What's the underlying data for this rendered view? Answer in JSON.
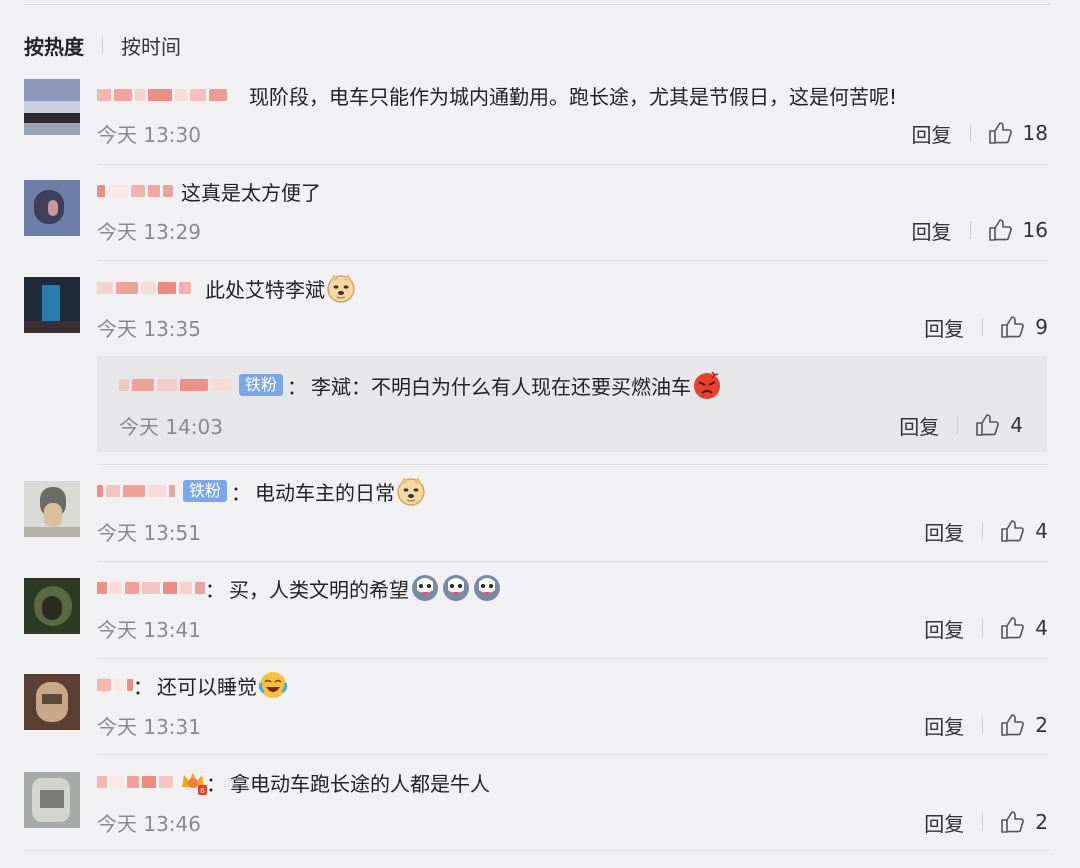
{
  "sort": {
    "hot_label": "按热度",
    "time_label": "按时间"
  },
  "reply_label": "回复",
  "colors": {
    "background": "#f1f1f3",
    "badge": "#7aa7e8",
    "time_text": "#8a8a8a"
  },
  "comments": [
    {
      "username": "",
      "text": "现阶段，电车只能作为城内通勤用。跑长途，尤其是节假日，这是何苦呢!",
      "time": "今天 13:30",
      "likes": "18",
      "emoji": []
    },
    {
      "username": "",
      "text": "这真是太方便了",
      "time": "今天 13:29",
      "likes": "16",
      "emoji": []
    },
    {
      "username": "",
      "text": "此处艾特李斌",
      "time": "今天 13:35",
      "likes": "9",
      "emoji": [
        "doge"
      ],
      "reply": {
        "username": "",
        "badge": "铁粉",
        "text": "李斌：不明白为什么有人现在还要买燃油车",
        "time": "今天 14:03",
        "likes": "4",
        "emoji": [
          "angry"
        ]
      }
    },
    {
      "username": "",
      "badge": "铁粉",
      "text": "电动车主的日常",
      "time": "今天 13:51",
      "likes": "4",
      "emoji": [
        "doge"
      ]
    },
    {
      "username": "",
      "text": "买，人类文明的希望",
      "time": "今天 13:41",
      "likes": "4",
      "emoji": [
        "husky",
        "husky",
        "husky"
      ]
    },
    {
      "username": "",
      "text": "还可以睡觉",
      "time": "今天 13:31",
      "likes": "2",
      "emoji": [
        "laugh-cry"
      ]
    },
    {
      "username": "",
      "text": "拿电动车跑长途的人都是牛人",
      "time": "今天 13:46",
      "likes": "2",
      "emoji": [
        "crown-badge"
      ]
    }
  ]
}
